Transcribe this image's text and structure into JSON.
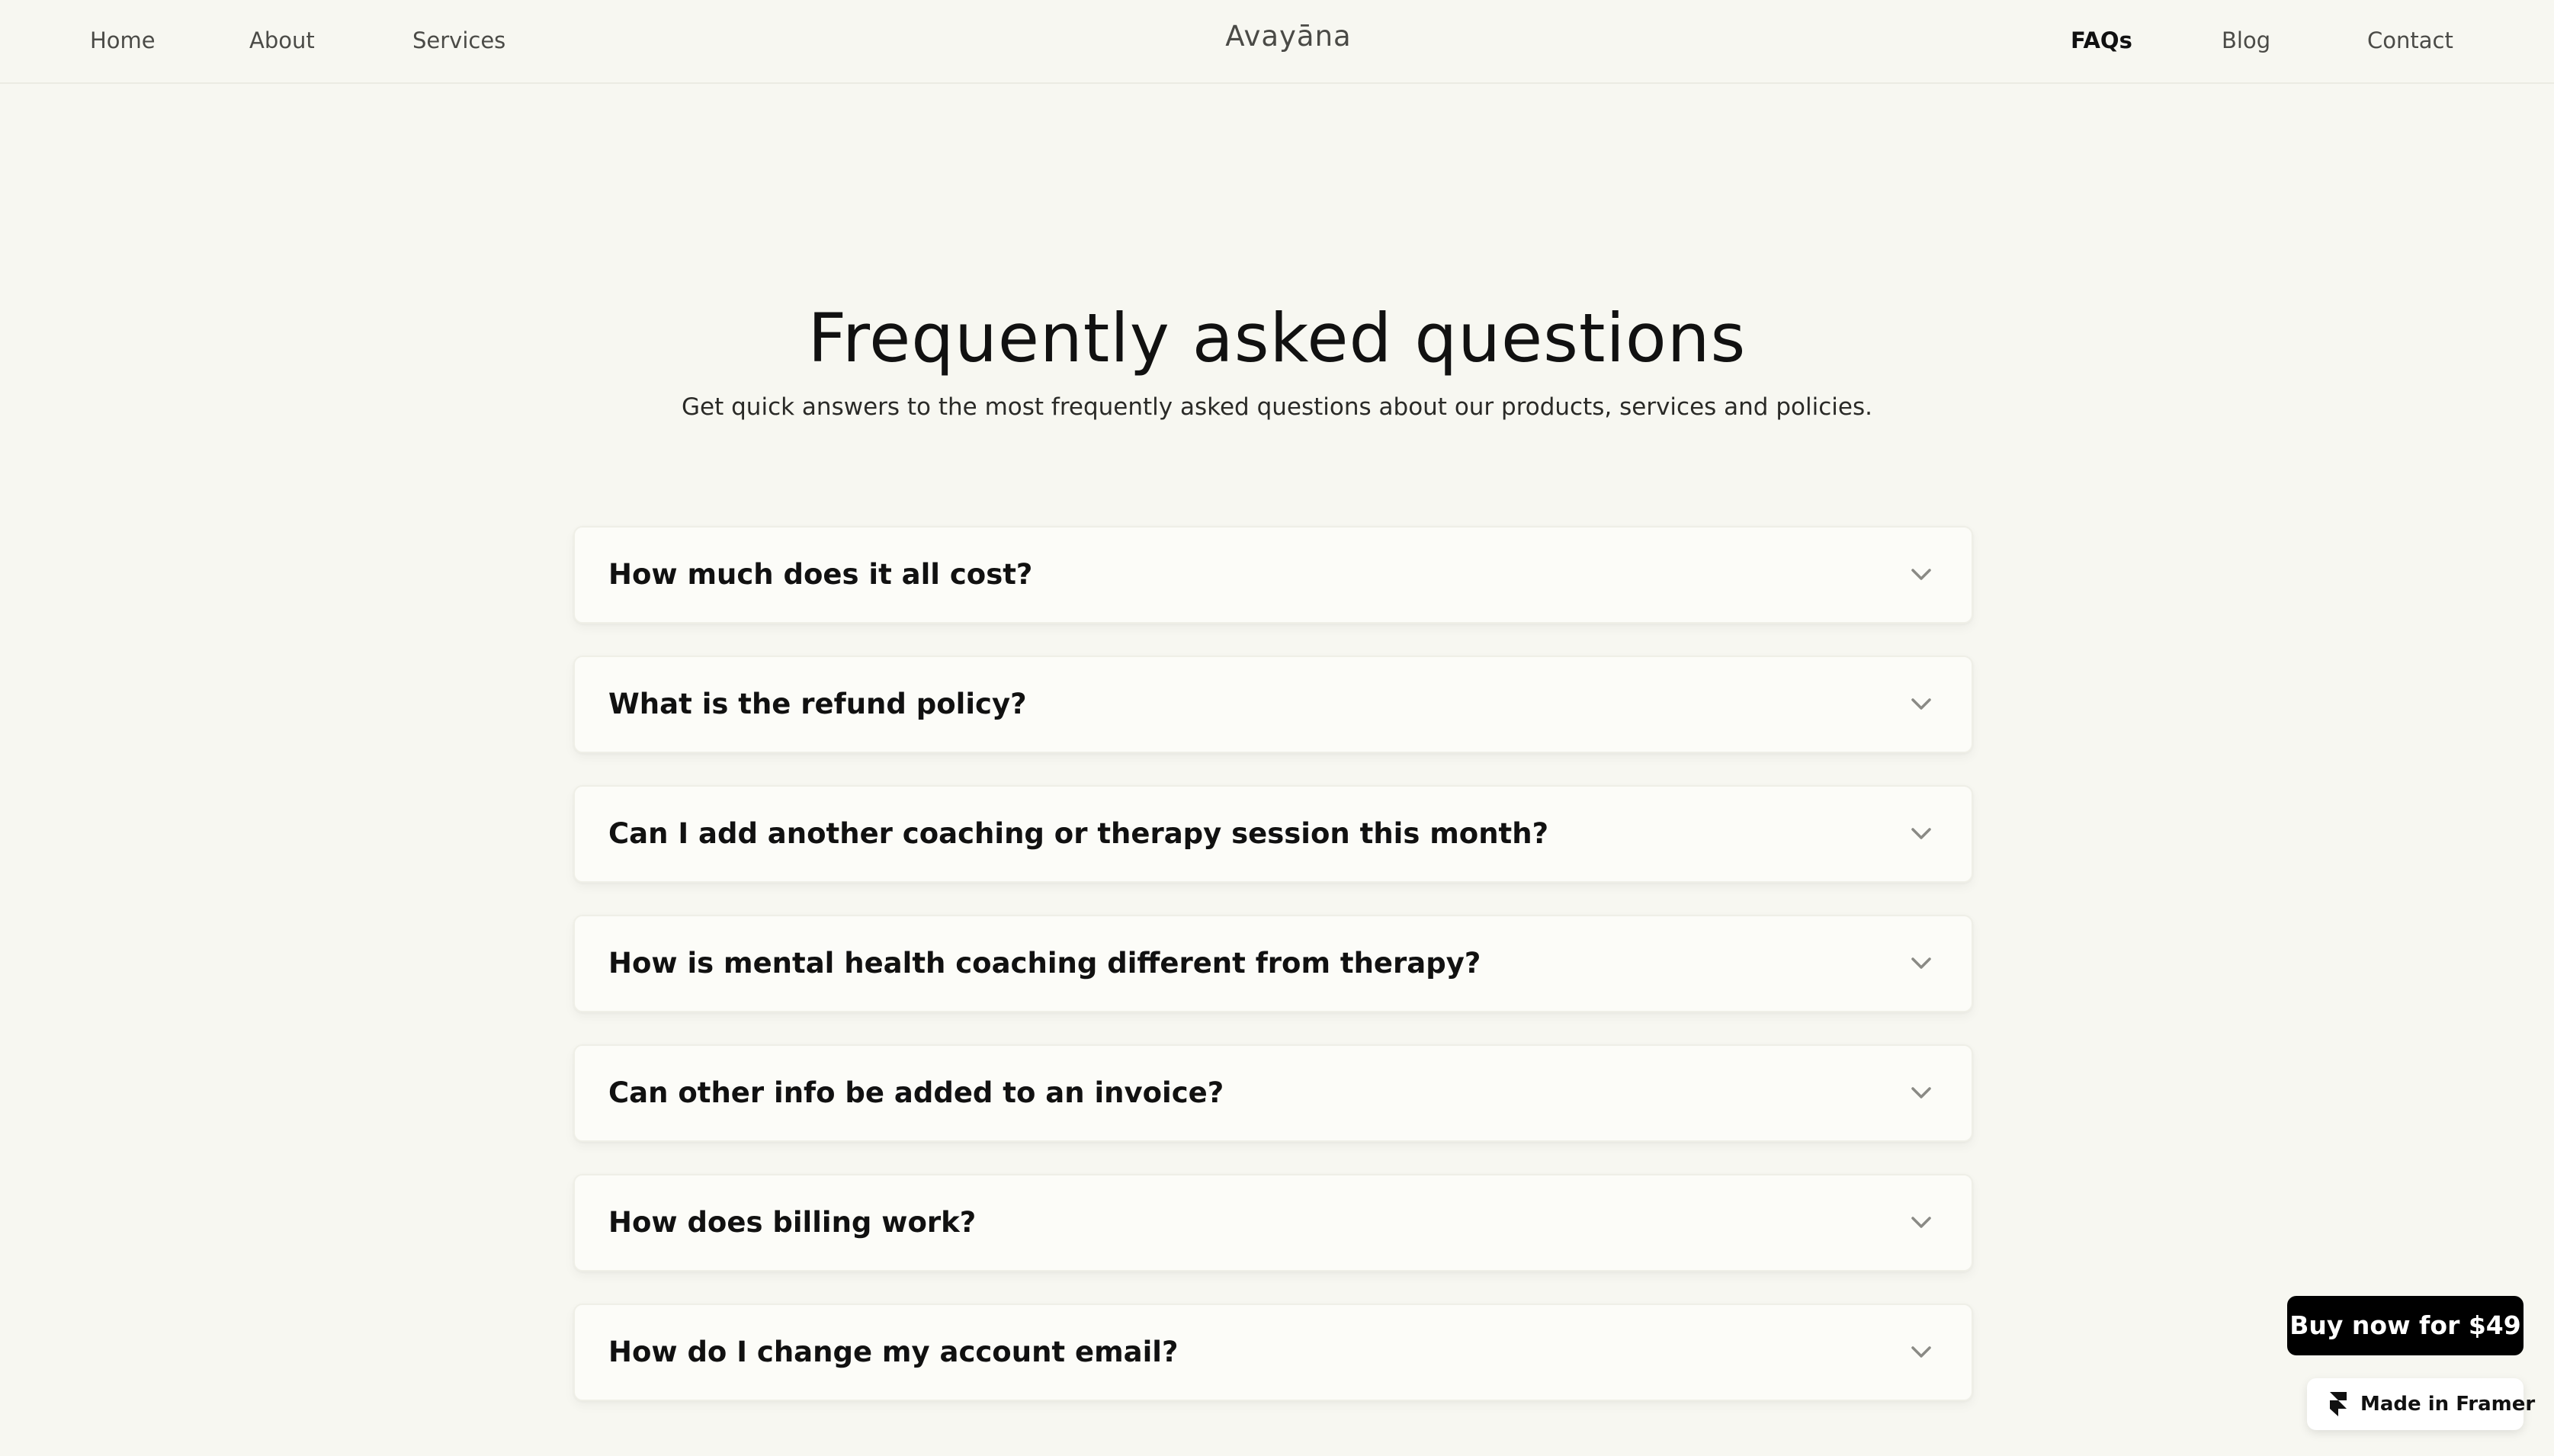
{
  "header": {
    "brand": "Avayāna",
    "nav_left": [
      {
        "label": "Home"
      },
      {
        "label": "About"
      },
      {
        "label": "Services"
      }
    ],
    "nav_right": [
      {
        "label": "FAQs",
        "active": true
      },
      {
        "label": "Blog"
      },
      {
        "label": "Contact"
      }
    ]
  },
  "hero": {
    "title": "Frequently asked questions",
    "subtitle": "Get quick answers to the most frequently asked questions about our products, services and policies."
  },
  "faq": {
    "items": [
      {
        "question": "How much does it all cost?",
        "icon": "chevron-down-icon"
      },
      {
        "question": "What is the refund policy?",
        "icon": "chevron-down-icon"
      },
      {
        "question": "Can I add another coaching or therapy session this month?",
        "icon": "chevron-down-icon"
      },
      {
        "question": "How is mental health coaching different from therapy?",
        "icon": "chevron-down-icon"
      },
      {
        "question": "Can other info be added to an invoice?",
        "icon": "chevron-down-icon"
      },
      {
        "question": "How does billing work?",
        "icon": "chevron-down-icon"
      },
      {
        "question": "How do I change my account email?",
        "icon": "chevron-down-icon"
      }
    ]
  },
  "floating": {
    "buy_label": "Buy now for $49",
    "made_in_label": "Made in Framer",
    "made_in_icon": "framer-logo-icon"
  },
  "colors": {
    "background": "#f7f7f1",
    "card": "#fcfcf8",
    "text": "#111111",
    "chevron": "#8a8a85",
    "buy_button": "#000000"
  }
}
